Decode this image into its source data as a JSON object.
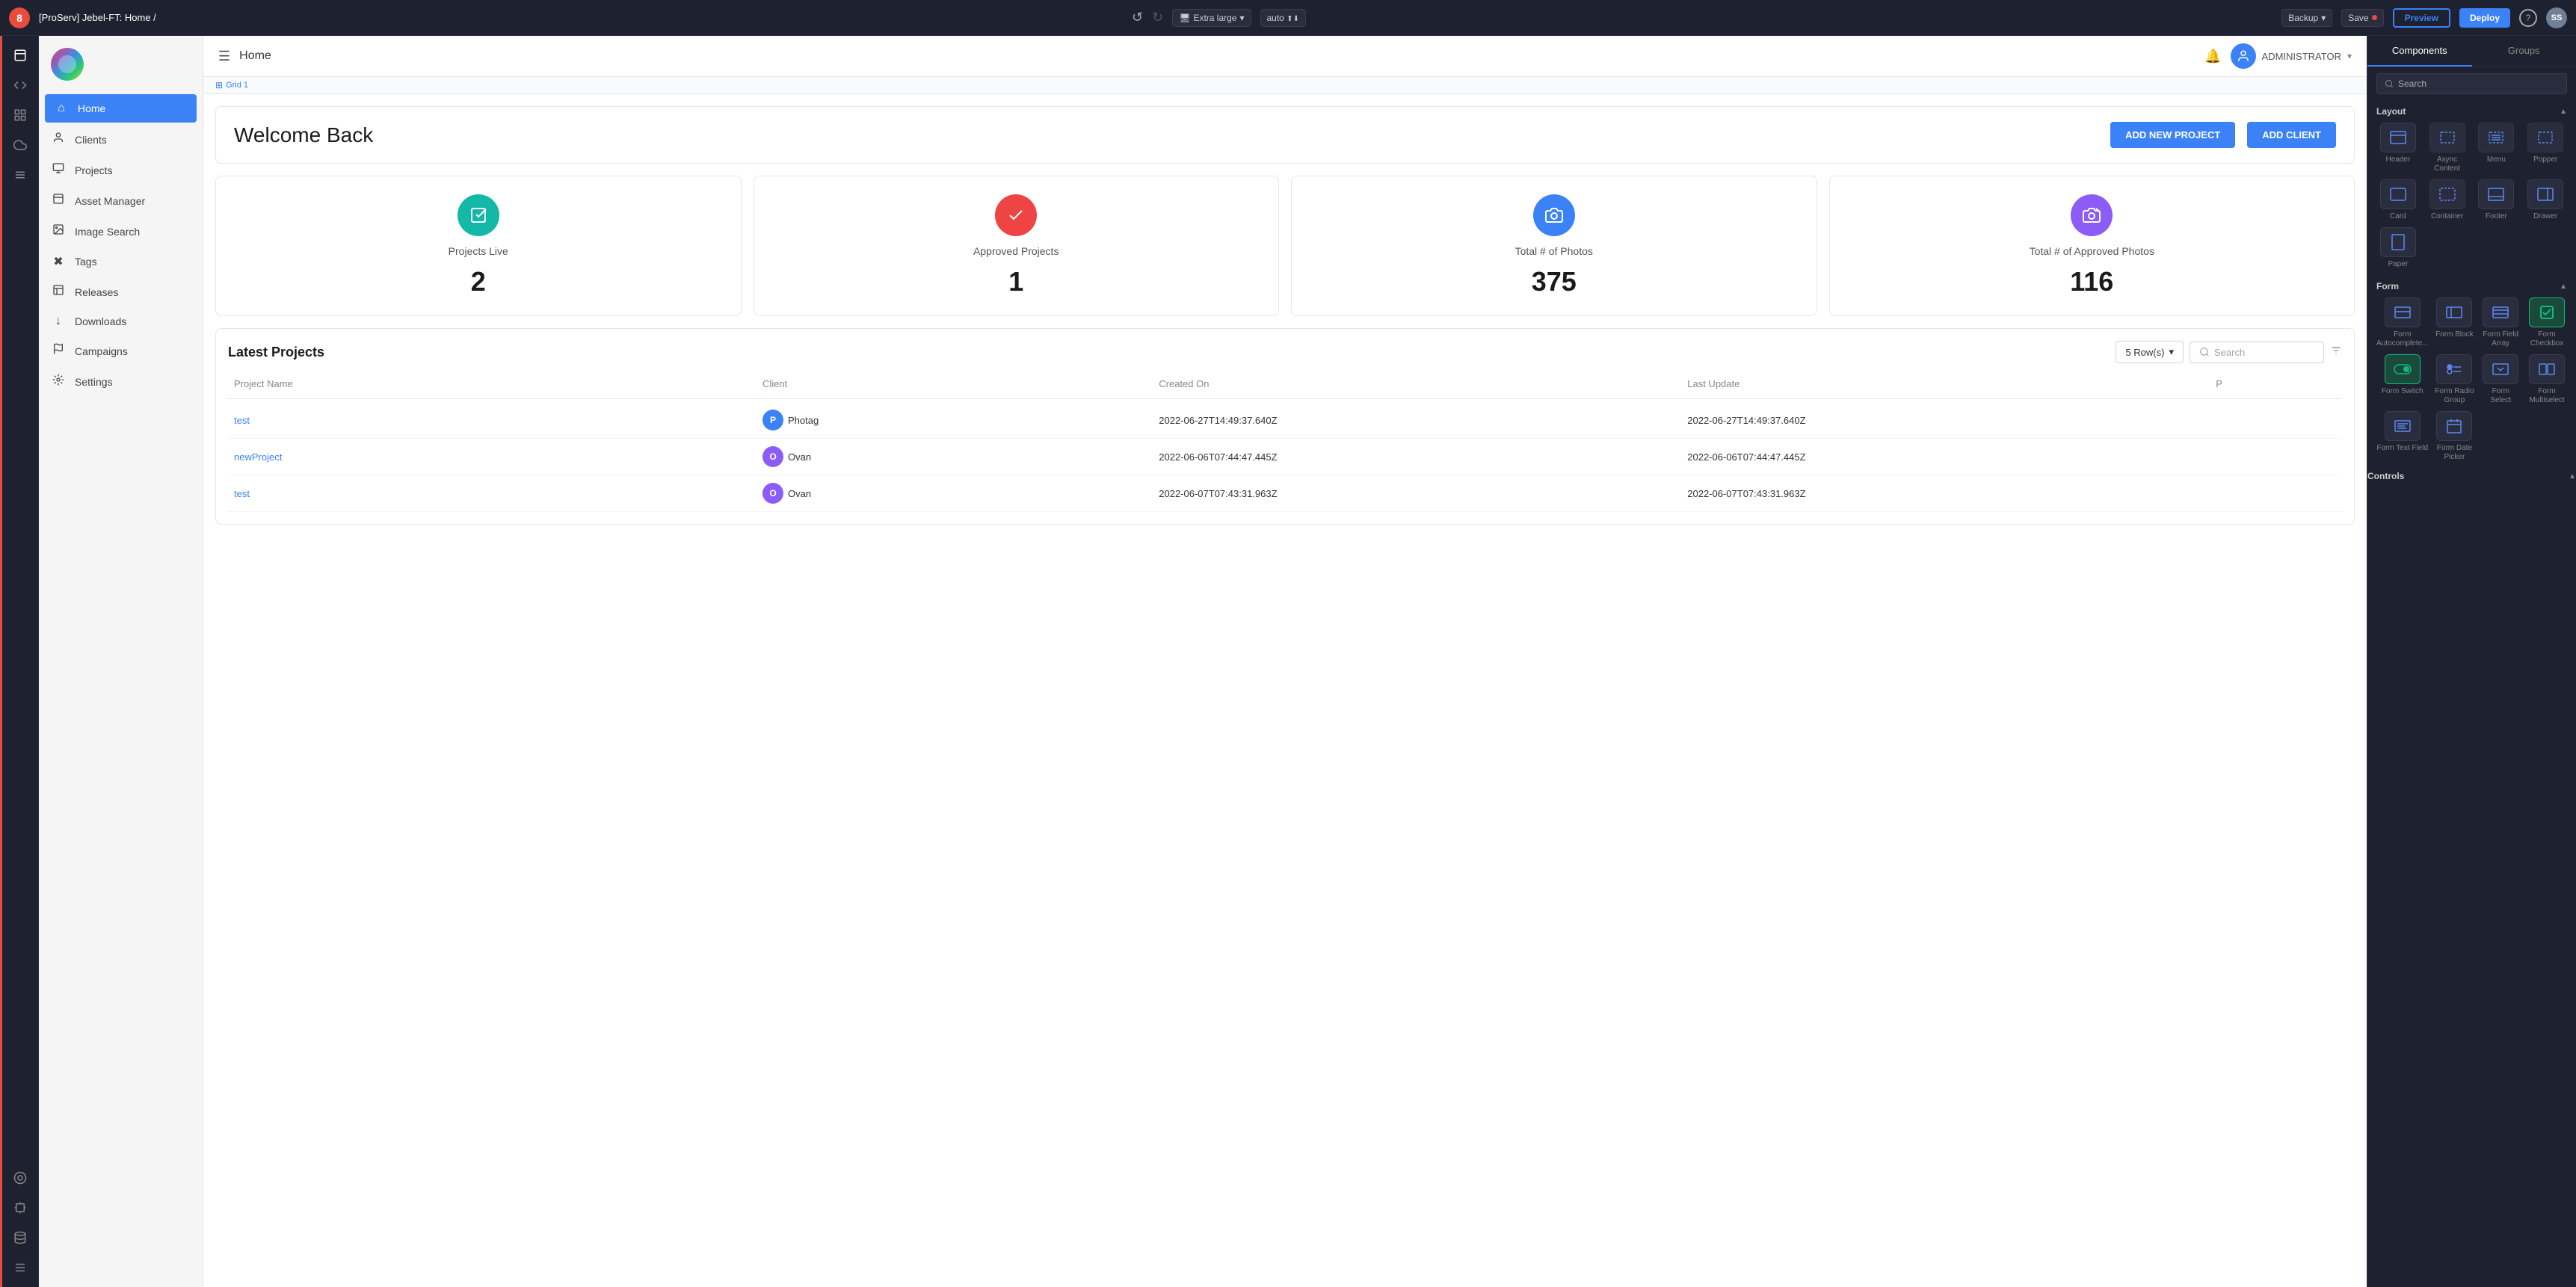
{
  "topbar": {
    "logo_label": "8",
    "title": "[ProServ] Jebel-FT: Home",
    "title_sub": "/",
    "device": "Extra large",
    "auto_label": "auto",
    "backup_label": "Backup",
    "save_label": "Save",
    "preview_label": "Preview",
    "deploy_label": "Deploy",
    "help_label": "?",
    "avatar_label": "SS"
  },
  "iconbar": {
    "icons": [
      "📄",
      "{;}",
      "⊞",
      "☁",
      "ƒx",
      "◎",
      "⊡",
      "⚙"
    ]
  },
  "sidebar": {
    "nav_items": [
      {
        "id": "home",
        "label": "Home",
        "icon": "⌂",
        "active": true
      },
      {
        "id": "clients",
        "label": "Clients",
        "icon": "👤"
      },
      {
        "id": "projects",
        "label": "Projects",
        "icon": "🖨"
      },
      {
        "id": "asset-manager",
        "label": "Asset Manager",
        "icon": "📕"
      },
      {
        "id": "image-search",
        "label": "Image Search",
        "icon": "📊"
      },
      {
        "id": "tags",
        "label": "Tags",
        "icon": "✖"
      },
      {
        "id": "releases",
        "label": "Releases",
        "icon": "📋"
      },
      {
        "id": "downloads",
        "label": "Downloads",
        "icon": "↓"
      },
      {
        "id": "campaigns",
        "label": "Campaigns",
        "icon": "🔄"
      },
      {
        "id": "settings",
        "label": "Settings",
        "icon": "⚙"
      }
    ]
  },
  "content": {
    "header_title": "Home",
    "header_user": "ADMINISTRATOR",
    "grid_label": "Grid 1",
    "welcome_title": "Welcome Back",
    "btn_add_project": "ADD NEW PROJECT",
    "btn_add_client": "ADD CLIENT",
    "stats": [
      {
        "id": "projects-live",
        "icon": "📋",
        "icon_type": "teal",
        "label": "Projects Live",
        "value": "2"
      },
      {
        "id": "approved-projects",
        "icon": "✔",
        "icon_type": "red",
        "label": "Approved Projects",
        "value": "1"
      },
      {
        "id": "total-photos",
        "icon": "📷",
        "icon_type": "blue",
        "label": "Total # of Photos",
        "value": "375"
      },
      {
        "id": "approved-photos",
        "icon": "📷+",
        "icon_type": "purple",
        "label": "Total # of Approved Photos",
        "value": "116"
      }
    ],
    "table_title": "Latest Projects",
    "rows_label": "5 Row(s)",
    "search_placeholder": "Search",
    "columns": [
      "Project Name",
      "Client",
      "Created On",
      "Last Update",
      "P"
    ],
    "rows": [
      {
        "name": "test",
        "client_abbr": "P",
        "client_name": "Photag",
        "client_color": "blue",
        "created": "2022-06-27T14:49:37.640Z",
        "updated": "2022-06-27T14:49:37.640Z"
      },
      {
        "name": "newProject",
        "client_abbr": "O",
        "client_name": "Ovan",
        "client_color": "purple",
        "created": "2022-06-06T07:44:47.445Z",
        "updated": "2022-06-06T07:44:47.445Z"
      },
      {
        "name": "test",
        "client_abbr": "O",
        "client_name": "Ovan",
        "client_color": "purple",
        "created": "2022-06-07T07:43:31.963Z",
        "updated": "2022-06-07T07:43:31.963Z"
      }
    ]
  },
  "right_panel": {
    "tab_components": "Components",
    "tab_groups": "Groups",
    "search_placeholder": "Search",
    "layout_label": "Layout",
    "layout_components": [
      {
        "id": "header",
        "label": "Header"
      },
      {
        "id": "async-content",
        "label": "Async Content"
      },
      {
        "id": "menu",
        "label": "Menu"
      },
      {
        "id": "popper",
        "label": "Popper"
      },
      {
        "id": "card",
        "label": "Card"
      },
      {
        "id": "container",
        "label": "Container"
      },
      {
        "id": "footer",
        "label": "Footer"
      },
      {
        "id": "drawer",
        "label": "Drawer"
      },
      {
        "id": "paper",
        "label": "Paper"
      }
    ],
    "form_label": "Form",
    "form_components": [
      {
        "id": "form-autocomplete",
        "label": "Form Autocomplete..."
      },
      {
        "id": "form-block",
        "label": "Form Block"
      },
      {
        "id": "form-field-array",
        "label": "Form Field Array"
      },
      {
        "id": "form-checkbox",
        "label": "Form Checkbox"
      },
      {
        "id": "form-switch",
        "label": "Form Switch"
      },
      {
        "id": "form-radio-group",
        "label": "Form Radio Group"
      },
      {
        "id": "form-select",
        "label": "Form Select"
      },
      {
        "id": "form-multiselect",
        "label": "Form Multiselect"
      },
      {
        "id": "form-text-field",
        "label": "Form Text Field"
      },
      {
        "id": "form-date-picker",
        "label": "Form Date Picker"
      }
    ],
    "controls_label": "Controls"
  }
}
